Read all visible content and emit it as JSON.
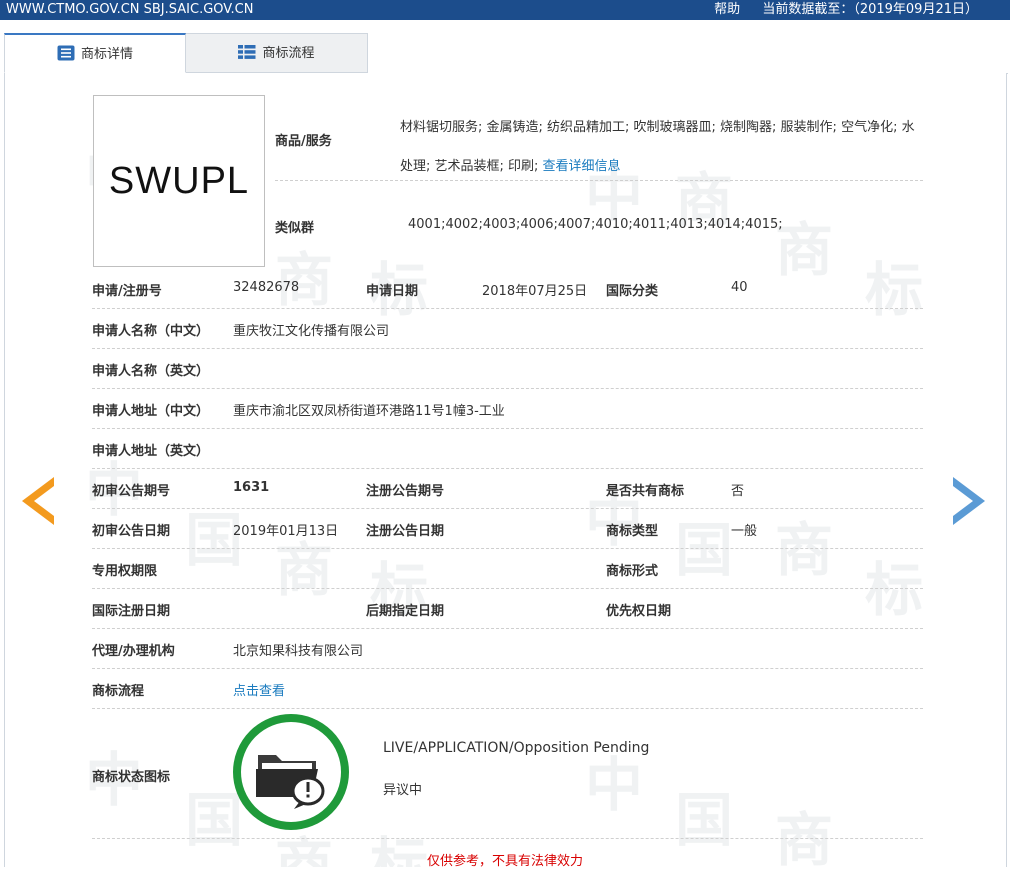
{
  "topbar": {
    "sites": "WWW.CTMO.GOV.CN SBJ.SAIC.GOV.CN",
    "help": "帮助",
    "data_as_of": "当前数据截至：（2019年09月21日）",
    "background": "#1c4d8c"
  },
  "tabs": [
    {
      "label": "商标详情",
      "icon": "document-list-icon",
      "active": true
    },
    {
      "label": "商标流程",
      "icon": "grid-list-icon",
      "active": false
    }
  ],
  "watermark": {
    "chars": [
      "中",
      "国",
      "商",
      "标"
    ]
  },
  "trademark": {
    "logo_text": "SWUPL",
    "goods_label": "商品/服务",
    "goods_text": "材料锯切服务; 金属铸造; 纺织品精加工; 吹制玻璃器皿; 烧制陶器; 服装制作; 空气净化; 水处理; 艺术品装框; 印刷;",
    "goods_more": "查看详细信息",
    "similar_label": "类似群",
    "similar_value": "4001;4002;4003;4006;4007;4010;4011;4013;4014;4015;"
  },
  "rows": {
    "reg_no_label": "申请/注册号",
    "reg_no": "32482678",
    "app_date_label": "申请日期",
    "app_date": "2018年07月25日",
    "intl_class_label": "国际分类",
    "intl_class": "40",
    "applicant_cn_label": "申请人名称（中文）",
    "applicant_cn": "重庆牧江文化传播有限公司",
    "applicant_en_label": "申请人名称（英文）",
    "applicant_en": "",
    "address_cn_label": "申请人地址（中文）",
    "address_cn": "重庆市渝北区双凤桥街道环港路11号1幢3-工业",
    "address_en_label": "申请人地址（英文）",
    "address_en": "",
    "prelim_no_label": "初审公告期号",
    "prelim_no": "1631",
    "reg_pub_no_label": "注册公告期号",
    "reg_pub_no": "",
    "shared_label": "是否共有商标",
    "shared": "否",
    "prelim_date_label": "初审公告日期",
    "prelim_date": "2019年01月13日",
    "reg_pub_date_label": "注册公告日期",
    "reg_pub_date": "",
    "tm_type_label": "商标类型",
    "tm_type": "一般",
    "exclusive_label": "专用权期限",
    "exclusive": "",
    "tm_form_label": "商标形式",
    "tm_form": "",
    "intl_reg_date_label": "国际注册日期",
    "intl_reg_date": "",
    "later_date_label": "后期指定日期",
    "later_date": "",
    "priority_label": "优先权日期",
    "priority": "",
    "agent_label": "代理/办理机构",
    "agent": "北京知果科技有限公司",
    "flow_label": "商标流程",
    "flow_link": "点击查看",
    "status_label": "商标状态图标",
    "status_en": "LIVE/APPLICATION/Opposition Pending",
    "status_cn": "异议中"
  },
  "disclaimer": "仅供参考，不具有法律效力",
  "colors": {
    "link": "#1a7bbf",
    "status_ring": "#1f9a3a",
    "left_arrow": "#f39a1e",
    "right_arrow": "#5b9bd5",
    "disclaimer": "#d80000"
  }
}
